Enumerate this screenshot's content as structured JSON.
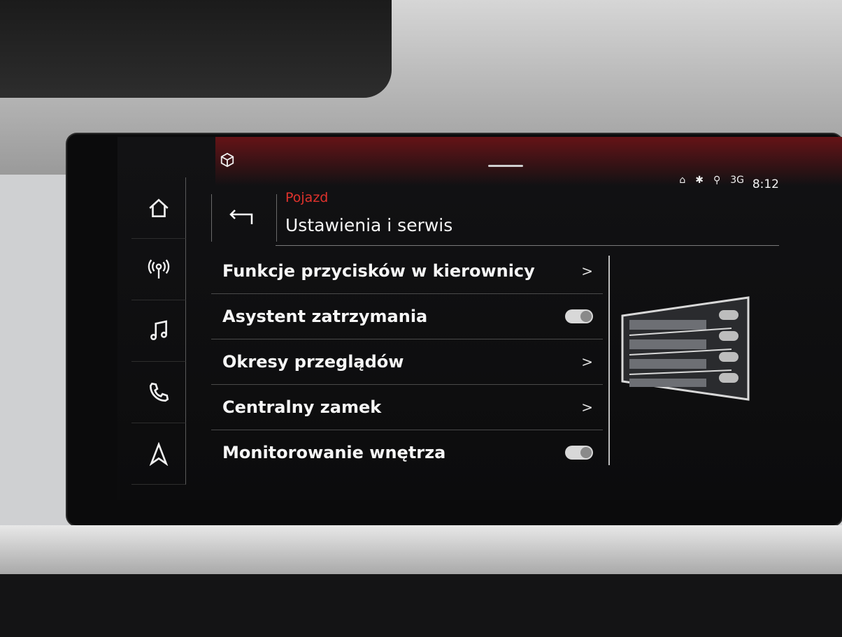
{
  "header": {
    "breadcrumb": "Pojazd",
    "title": "Ustawienia i serwis",
    "time": "8:12",
    "network": "3G"
  },
  "nav": {
    "items": [
      {
        "icon": "home-icon"
      },
      {
        "icon": "radio-icon"
      },
      {
        "icon": "music-icon"
      },
      {
        "icon": "phone-icon"
      },
      {
        "icon": "navigation-icon"
      }
    ]
  },
  "list": {
    "items": [
      {
        "label": "Funkcje przycisków w kierownicy",
        "control": "chevron",
        "value": ">"
      },
      {
        "label": "Asystent zatrzymania",
        "control": "toggle",
        "state": "on"
      },
      {
        "label": "Okresy przeglądów",
        "control": "chevron",
        "value": ">"
      },
      {
        "label": "Centralny zamek",
        "control": "chevron",
        "value": ">"
      },
      {
        "label": "Monitorowanie wnętrza",
        "control": "toggle",
        "state": "on"
      }
    ]
  },
  "colors": {
    "accent_red": "#e0322c",
    "background": "#0c0c0d",
    "text": "#f4f4f4"
  }
}
